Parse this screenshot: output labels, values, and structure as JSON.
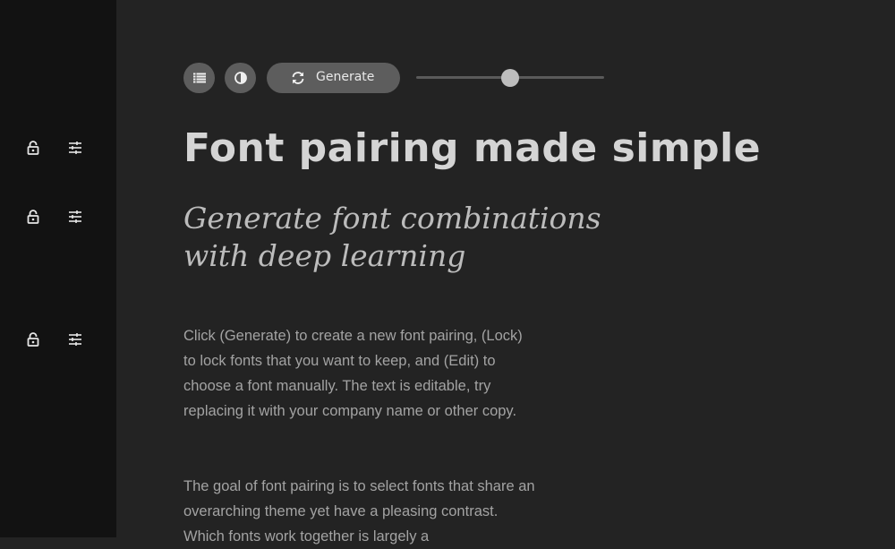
{
  "sidebar": {
    "rows": [
      {
        "lock_icon": "lock-open-icon",
        "edit_icon": "tune-icon"
      },
      {
        "lock_icon": "lock-open-icon",
        "edit_icon": "tune-icon"
      },
      {
        "lock_icon": "lock-open-icon",
        "edit_icon": "tune-icon"
      }
    ]
  },
  "toolbar": {
    "list_icon": "list-icon",
    "contrast_icon": "contrast-icon",
    "generate_icon": "refresh-icon",
    "generate_label": "Generate",
    "slider_value": 0.5
  },
  "content": {
    "title": "Font pairing made simple",
    "subtitle_line1": "Generate font combinations",
    "subtitle_line2": "with deep learning",
    "paragraph1": "Click (Generate) to create a new font pairing, (Lock) to lock fonts that you want to keep, and (Edit) to choose a font manually. The text is editable, try replacing it with your company name or other copy.",
    "paragraph2": "The goal of font pairing is to select fonts that share an overarching theme yet have a pleasing contrast. Which fonts work together is largely a"
  },
  "colors": {
    "background": "#232323",
    "sidebar": "#121212",
    "button": "#5d5d5d",
    "title": "#d4d4d4",
    "body_text": "#a3a3a3"
  }
}
